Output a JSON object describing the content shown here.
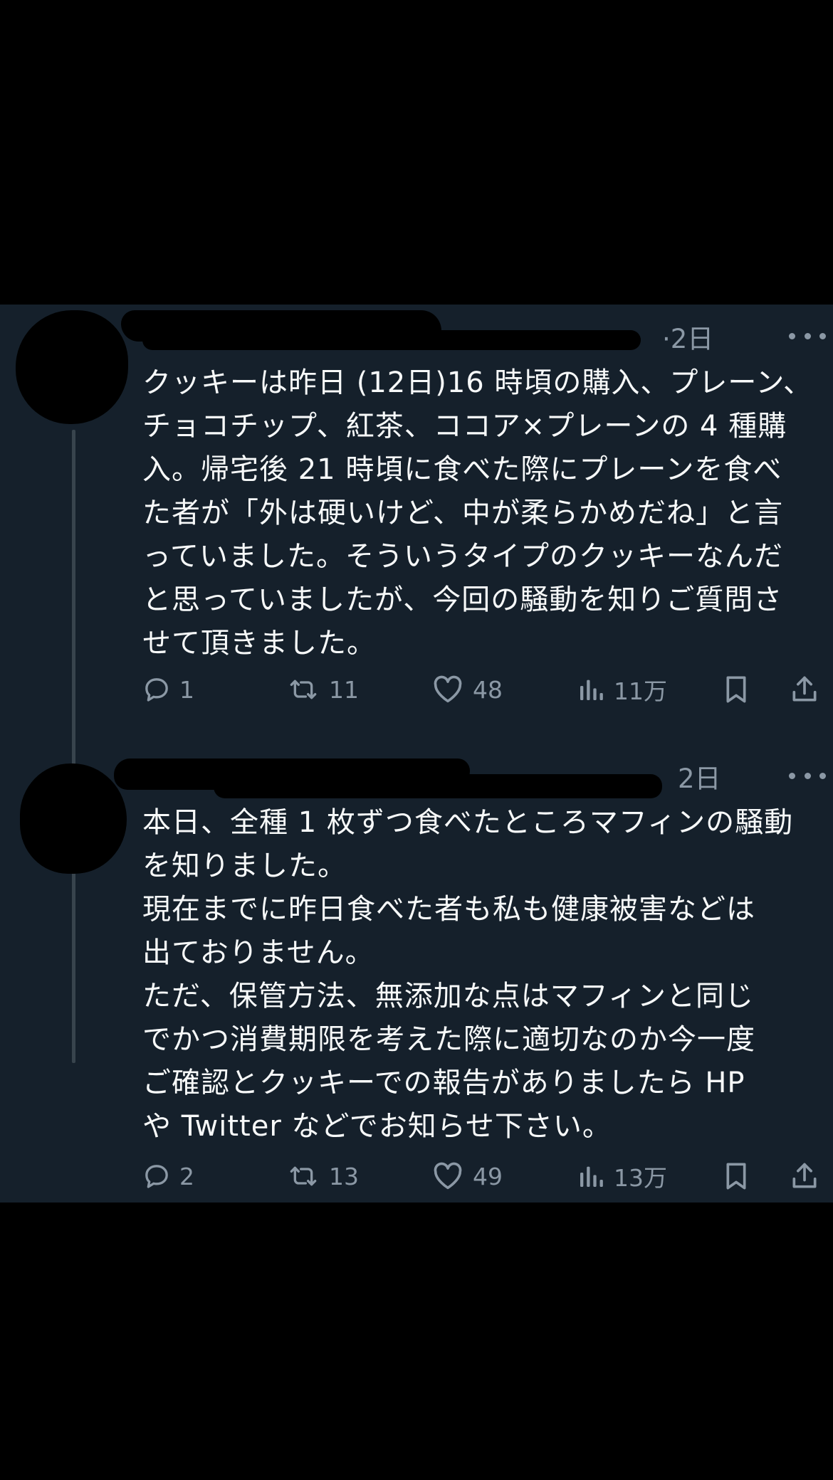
{
  "tweets": [
    {
      "timestamp": "·2日",
      "text_lines": [
        "クッキーは昨日 (12日)16 時頃の購入、プレーン、",
        "チョコチップ、紅茶、ココア×プレーンの 4 種購",
        "入。帰宅後 21 時頃に食べた際にプレーンを食べ",
        "た者が「外は硬いけど、中が柔らかめだね」と言",
        "っていました。そういうタイプのクッキーなんだ",
        "と思っていましたが、今回の騒動を知りご質問さ",
        "せて頂きました。"
      ],
      "actions": {
        "replies": "1",
        "retweets": "11",
        "likes": "48",
        "views": "11万"
      }
    },
    {
      "timestamp": "2日",
      "text_lines": [
        "本日、全種 1 枚ずつ食べたところマフィンの騒動",
        "を知りました。",
        "現在までに昨日食べた者も私も健康被害などは",
        "出ておりません。",
        "ただ、保管方法、無添加な点はマフィンと同じ",
        "でかつ消費期限を考えた際に適切なのか今一度",
        "ご確認とクッキーでの報告がありましたら HP",
        "や Twitter などでお知らせ下さい。"
      ],
      "actions": {
        "replies": "2",
        "retweets": "13",
        "likes": "49",
        "views": "13万"
      }
    }
  ],
  "icons": {
    "reply": "reply-icon",
    "retweet": "retweet-icon",
    "like": "heart-icon",
    "views": "views-bar-chart-icon",
    "bookmark": "bookmark-icon",
    "share": "share-icon",
    "more": "more-dots-icon"
  },
  "colors": {
    "background": "#15202b",
    "text": "#f7f9f9",
    "muted": "#8b98a5",
    "thread_line": "#38444d"
  }
}
